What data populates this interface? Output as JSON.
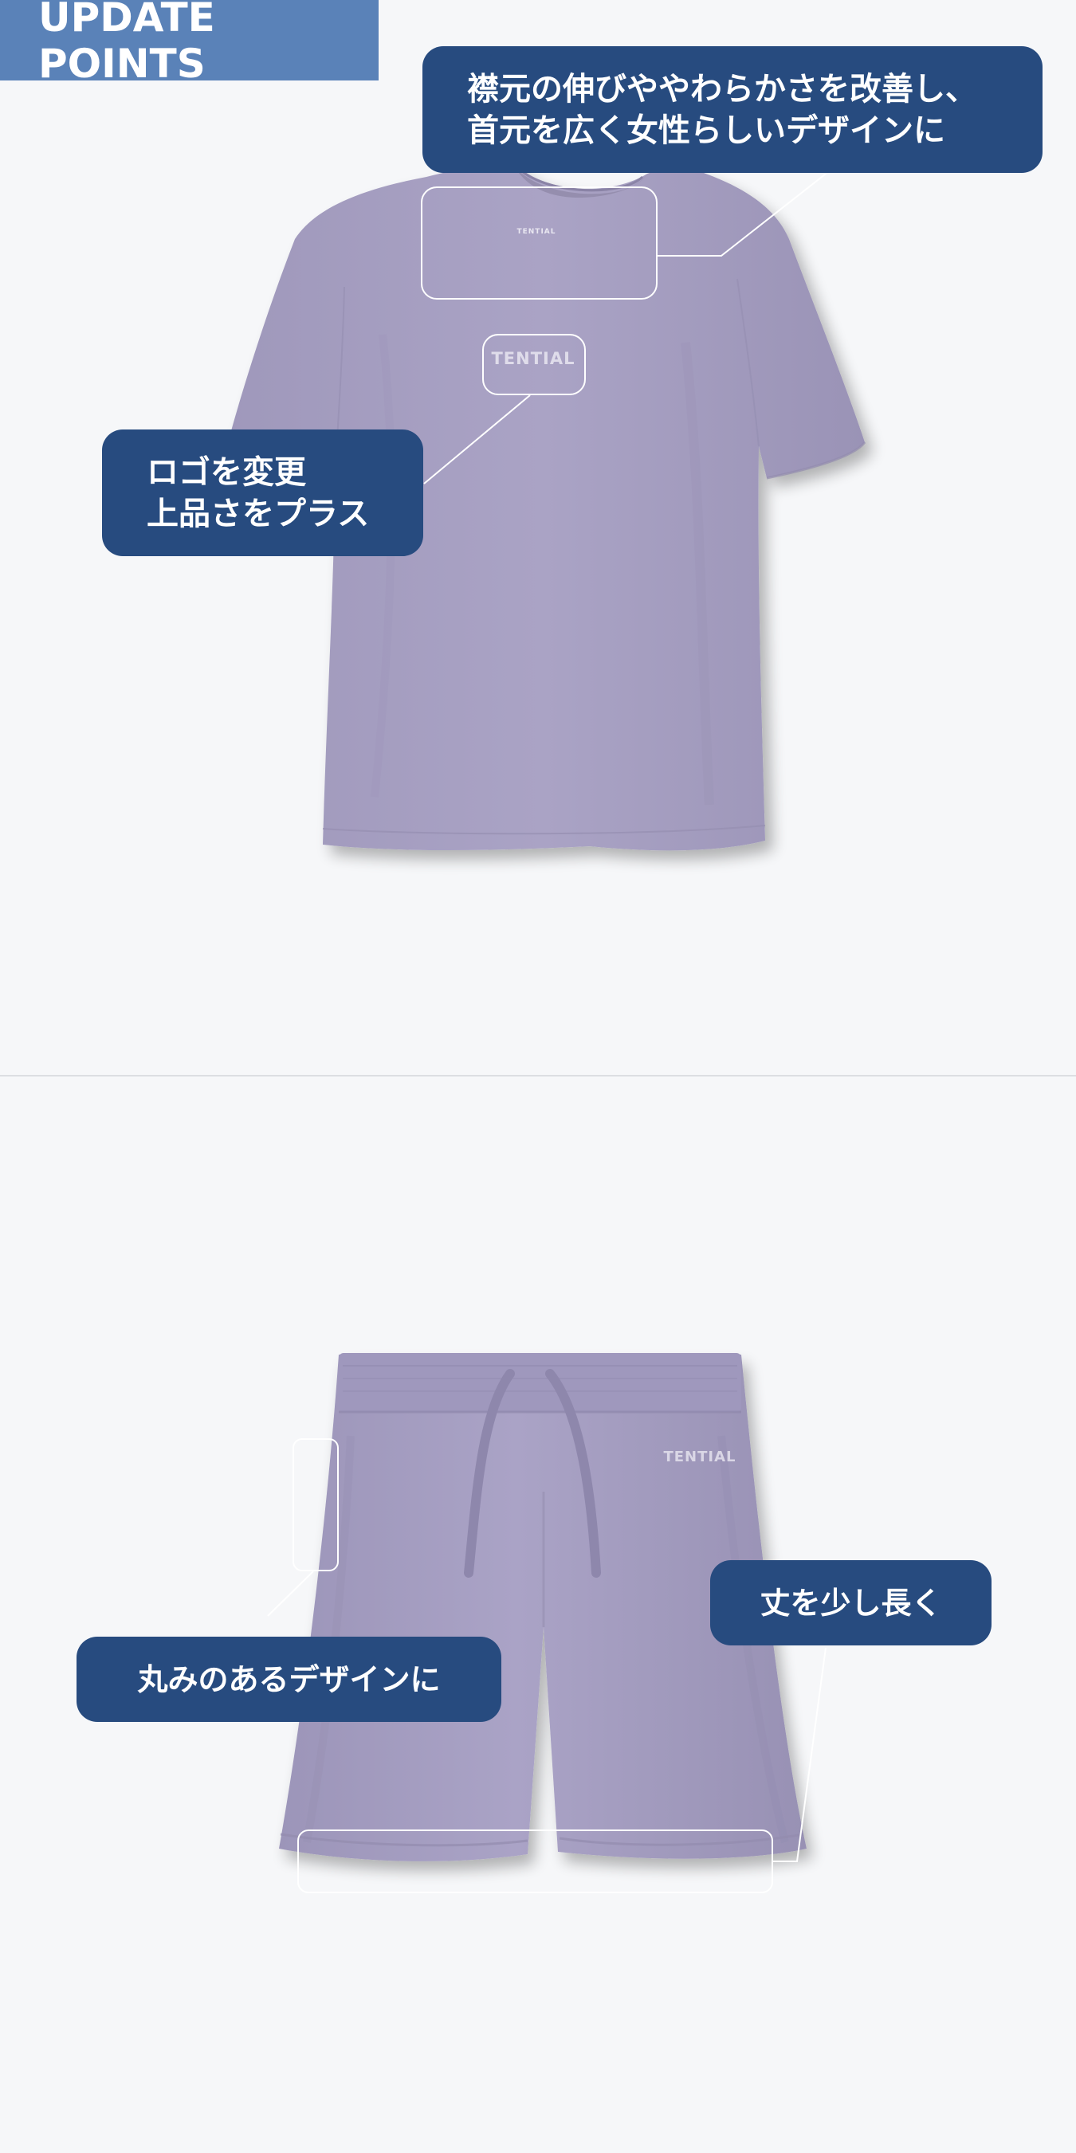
{
  "header": {
    "title": "UPDATE POINTS"
  },
  "tshirt": {
    "brand_logo": "TENTIAL",
    "callouts": {
      "neck": [
        "襟元の伸びややわらかさを改善し、",
        "首元を広く女性らしいデザインに"
      ],
      "logo": [
        "ロゴを変更",
        "上品さをプラス"
      ]
    }
  },
  "shorts": {
    "brand_logo": "TENTIAL",
    "callouts": {
      "length": [
        "丈を少し長く"
      ],
      "shape": [
        "丸みのあるデザインに"
      ]
    }
  },
  "colors": {
    "background": "#f6f7f9",
    "header_badge": "#5a82b8",
    "callout": "#274b7f",
    "garment": "#a7a0c2",
    "highlight": "#ffffff"
  }
}
